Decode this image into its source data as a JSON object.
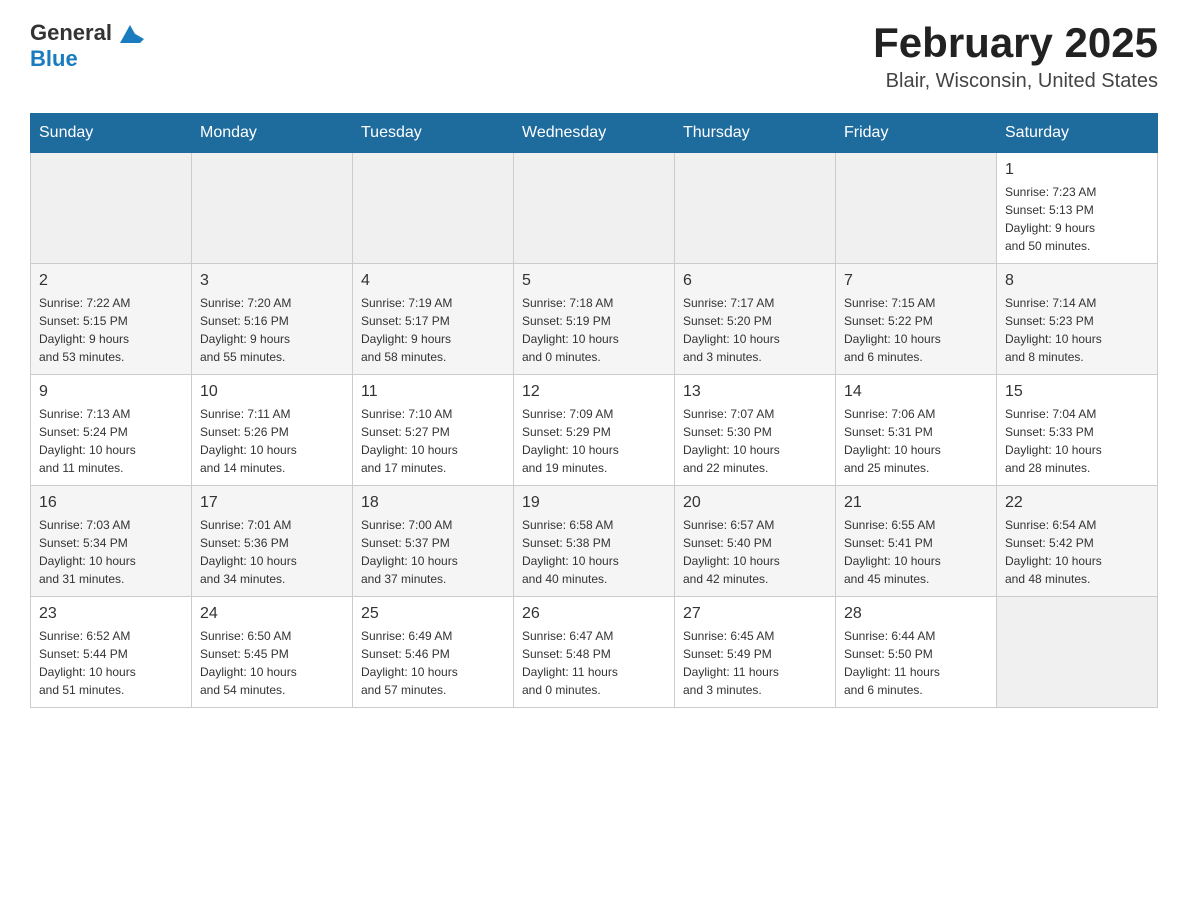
{
  "header": {
    "logo_general": "General",
    "logo_blue": "Blue",
    "month_title": "February 2025",
    "location": "Blair, Wisconsin, United States"
  },
  "weekdays": [
    "Sunday",
    "Monday",
    "Tuesday",
    "Wednesday",
    "Thursday",
    "Friday",
    "Saturday"
  ],
  "weeks": [
    [
      {
        "day": "",
        "info": ""
      },
      {
        "day": "",
        "info": ""
      },
      {
        "day": "",
        "info": ""
      },
      {
        "day": "",
        "info": ""
      },
      {
        "day": "",
        "info": ""
      },
      {
        "day": "",
        "info": ""
      },
      {
        "day": "1",
        "info": "Sunrise: 7:23 AM\nSunset: 5:13 PM\nDaylight: 9 hours\nand 50 minutes."
      }
    ],
    [
      {
        "day": "2",
        "info": "Sunrise: 7:22 AM\nSunset: 5:15 PM\nDaylight: 9 hours\nand 53 minutes."
      },
      {
        "day": "3",
        "info": "Sunrise: 7:20 AM\nSunset: 5:16 PM\nDaylight: 9 hours\nand 55 minutes."
      },
      {
        "day": "4",
        "info": "Sunrise: 7:19 AM\nSunset: 5:17 PM\nDaylight: 9 hours\nand 58 minutes."
      },
      {
        "day": "5",
        "info": "Sunrise: 7:18 AM\nSunset: 5:19 PM\nDaylight: 10 hours\nand 0 minutes."
      },
      {
        "day": "6",
        "info": "Sunrise: 7:17 AM\nSunset: 5:20 PM\nDaylight: 10 hours\nand 3 minutes."
      },
      {
        "day": "7",
        "info": "Sunrise: 7:15 AM\nSunset: 5:22 PM\nDaylight: 10 hours\nand 6 minutes."
      },
      {
        "day": "8",
        "info": "Sunrise: 7:14 AM\nSunset: 5:23 PM\nDaylight: 10 hours\nand 8 minutes."
      }
    ],
    [
      {
        "day": "9",
        "info": "Sunrise: 7:13 AM\nSunset: 5:24 PM\nDaylight: 10 hours\nand 11 minutes."
      },
      {
        "day": "10",
        "info": "Sunrise: 7:11 AM\nSunset: 5:26 PM\nDaylight: 10 hours\nand 14 minutes."
      },
      {
        "day": "11",
        "info": "Sunrise: 7:10 AM\nSunset: 5:27 PM\nDaylight: 10 hours\nand 17 minutes."
      },
      {
        "day": "12",
        "info": "Sunrise: 7:09 AM\nSunset: 5:29 PM\nDaylight: 10 hours\nand 19 minutes."
      },
      {
        "day": "13",
        "info": "Sunrise: 7:07 AM\nSunset: 5:30 PM\nDaylight: 10 hours\nand 22 minutes."
      },
      {
        "day": "14",
        "info": "Sunrise: 7:06 AM\nSunset: 5:31 PM\nDaylight: 10 hours\nand 25 minutes."
      },
      {
        "day": "15",
        "info": "Sunrise: 7:04 AM\nSunset: 5:33 PM\nDaylight: 10 hours\nand 28 minutes."
      }
    ],
    [
      {
        "day": "16",
        "info": "Sunrise: 7:03 AM\nSunset: 5:34 PM\nDaylight: 10 hours\nand 31 minutes."
      },
      {
        "day": "17",
        "info": "Sunrise: 7:01 AM\nSunset: 5:36 PM\nDaylight: 10 hours\nand 34 minutes."
      },
      {
        "day": "18",
        "info": "Sunrise: 7:00 AM\nSunset: 5:37 PM\nDaylight: 10 hours\nand 37 minutes."
      },
      {
        "day": "19",
        "info": "Sunrise: 6:58 AM\nSunset: 5:38 PM\nDaylight: 10 hours\nand 40 minutes."
      },
      {
        "day": "20",
        "info": "Sunrise: 6:57 AM\nSunset: 5:40 PM\nDaylight: 10 hours\nand 42 minutes."
      },
      {
        "day": "21",
        "info": "Sunrise: 6:55 AM\nSunset: 5:41 PM\nDaylight: 10 hours\nand 45 minutes."
      },
      {
        "day": "22",
        "info": "Sunrise: 6:54 AM\nSunset: 5:42 PM\nDaylight: 10 hours\nand 48 minutes."
      }
    ],
    [
      {
        "day": "23",
        "info": "Sunrise: 6:52 AM\nSunset: 5:44 PM\nDaylight: 10 hours\nand 51 minutes."
      },
      {
        "day": "24",
        "info": "Sunrise: 6:50 AM\nSunset: 5:45 PM\nDaylight: 10 hours\nand 54 minutes."
      },
      {
        "day": "25",
        "info": "Sunrise: 6:49 AM\nSunset: 5:46 PM\nDaylight: 10 hours\nand 57 minutes."
      },
      {
        "day": "26",
        "info": "Sunrise: 6:47 AM\nSunset: 5:48 PM\nDaylight: 11 hours\nand 0 minutes."
      },
      {
        "day": "27",
        "info": "Sunrise: 6:45 AM\nSunset: 5:49 PM\nDaylight: 11 hours\nand 3 minutes."
      },
      {
        "day": "28",
        "info": "Sunrise: 6:44 AM\nSunset: 5:50 PM\nDaylight: 11 hours\nand 6 minutes."
      },
      {
        "day": "",
        "info": ""
      }
    ]
  ]
}
